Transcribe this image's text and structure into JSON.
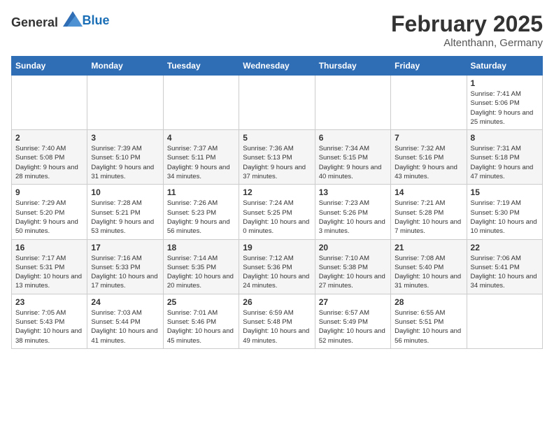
{
  "header": {
    "logo_general": "General",
    "logo_blue": "Blue",
    "month": "February 2025",
    "location": "Altenthann, Germany"
  },
  "weekdays": [
    "Sunday",
    "Monday",
    "Tuesday",
    "Wednesday",
    "Thursday",
    "Friday",
    "Saturday"
  ],
  "weeks": [
    [
      {
        "day": "",
        "info": ""
      },
      {
        "day": "",
        "info": ""
      },
      {
        "day": "",
        "info": ""
      },
      {
        "day": "",
        "info": ""
      },
      {
        "day": "",
        "info": ""
      },
      {
        "day": "",
        "info": ""
      },
      {
        "day": "1",
        "info": "Sunrise: 7:41 AM\nSunset: 5:06 PM\nDaylight: 9 hours and 25 minutes."
      }
    ],
    [
      {
        "day": "2",
        "info": "Sunrise: 7:40 AM\nSunset: 5:08 PM\nDaylight: 9 hours and 28 minutes."
      },
      {
        "day": "3",
        "info": "Sunrise: 7:39 AM\nSunset: 5:10 PM\nDaylight: 9 hours and 31 minutes."
      },
      {
        "day": "4",
        "info": "Sunrise: 7:37 AM\nSunset: 5:11 PM\nDaylight: 9 hours and 34 minutes."
      },
      {
        "day": "5",
        "info": "Sunrise: 7:36 AM\nSunset: 5:13 PM\nDaylight: 9 hours and 37 minutes."
      },
      {
        "day": "6",
        "info": "Sunrise: 7:34 AM\nSunset: 5:15 PM\nDaylight: 9 hours and 40 minutes."
      },
      {
        "day": "7",
        "info": "Sunrise: 7:32 AM\nSunset: 5:16 PM\nDaylight: 9 hours and 43 minutes."
      },
      {
        "day": "8",
        "info": "Sunrise: 7:31 AM\nSunset: 5:18 PM\nDaylight: 9 hours and 47 minutes."
      }
    ],
    [
      {
        "day": "9",
        "info": "Sunrise: 7:29 AM\nSunset: 5:20 PM\nDaylight: 9 hours and 50 minutes."
      },
      {
        "day": "10",
        "info": "Sunrise: 7:28 AM\nSunset: 5:21 PM\nDaylight: 9 hours and 53 minutes."
      },
      {
        "day": "11",
        "info": "Sunrise: 7:26 AM\nSunset: 5:23 PM\nDaylight: 9 hours and 56 minutes."
      },
      {
        "day": "12",
        "info": "Sunrise: 7:24 AM\nSunset: 5:25 PM\nDaylight: 10 hours and 0 minutes."
      },
      {
        "day": "13",
        "info": "Sunrise: 7:23 AM\nSunset: 5:26 PM\nDaylight: 10 hours and 3 minutes."
      },
      {
        "day": "14",
        "info": "Sunrise: 7:21 AM\nSunset: 5:28 PM\nDaylight: 10 hours and 7 minutes."
      },
      {
        "day": "15",
        "info": "Sunrise: 7:19 AM\nSunset: 5:30 PM\nDaylight: 10 hours and 10 minutes."
      }
    ],
    [
      {
        "day": "16",
        "info": "Sunrise: 7:17 AM\nSunset: 5:31 PM\nDaylight: 10 hours and 13 minutes."
      },
      {
        "day": "17",
        "info": "Sunrise: 7:16 AM\nSunset: 5:33 PM\nDaylight: 10 hours and 17 minutes."
      },
      {
        "day": "18",
        "info": "Sunrise: 7:14 AM\nSunset: 5:35 PM\nDaylight: 10 hours and 20 minutes."
      },
      {
        "day": "19",
        "info": "Sunrise: 7:12 AM\nSunset: 5:36 PM\nDaylight: 10 hours and 24 minutes."
      },
      {
        "day": "20",
        "info": "Sunrise: 7:10 AM\nSunset: 5:38 PM\nDaylight: 10 hours and 27 minutes."
      },
      {
        "day": "21",
        "info": "Sunrise: 7:08 AM\nSunset: 5:40 PM\nDaylight: 10 hours and 31 minutes."
      },
      {
        "day": "22",
        "info": "Sunrise: 7:06 AM\nSunset: 5:41 PM\nDaylight: 10 hours and 34 minutes."
      }
    ],
    [
      {
        "day": "23",
        "info": "Sunrise: 7:05 AM\nSunset: 5:43 PM\nDaylight: 10 hours and 38 minutes."
      },
      {
        "day": "24",
        "info": "Sunrise: 7:03 AM\nSunset: 5:44 PM\nDaylight: 10 hours and 41 minutes."
      },
      {
        "day": "25",
        "info": "Sunrise: 7:01 AM\nSunset: 5:46 PM\nDaylight: 10 hours and 45 minutes."
      },
      {
        "day": "26",
        "info": "Sunrise: 6:59 AM\nSunset: 5:48 PM\nDaylight: 10 hours and 49 minutes."
      },
      {
        "day": "27",
        "info": "Sunrise: 6:57 AM\nSunset: 5:49 PM\nDaylight: 10 hours and 52 minutes."
      },
      {
        "day": "28",
        "info": "Sunrise: 6:55 AM\nSunset: 5:51 PM\nDaylight: 10 hours and 56 minutes."
      },
      {
        "day": "",
        "info": ""
      }
    ]
  ]
}
